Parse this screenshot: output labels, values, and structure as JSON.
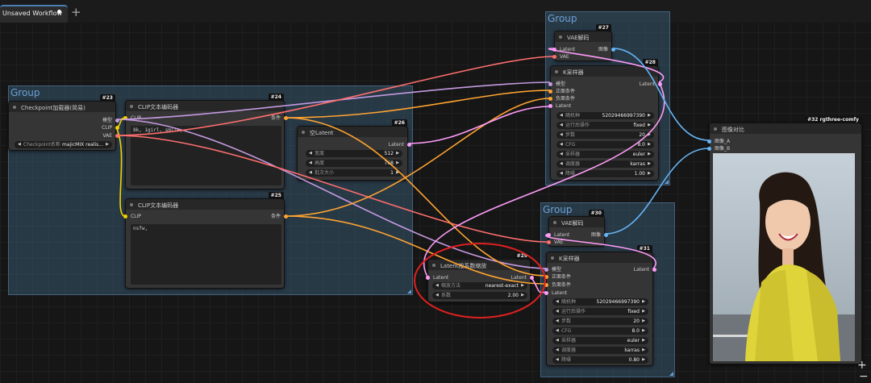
{
  "tabs": [
    {
      "label": "Unsaved Workflow",
      "modified": true
    }
  ],
  "new_tab_icon": "plus-icon",
  "groups": [
    {
      "title": "Group"
    },
    {
      "title": "Group"
    },
    {
      "title": "Group"
    }
  ],
  "nodes": {
    "n23": {
      "id": "#23",
      "title": "Checkpoint加载器(简易)",
      "outputs": {
        "model": "模型",
        "clip": "CLIP",
        "vae": "VAE"
      },
      "widget": {
        "name": "Checkpoint名称",
        "value": "majicMIX realis..."
      }
    },
    "n24": {
      "id": "#24",
      "title": "CLIP文本编码器",
      "input": "CLIP",
      "output": "条件",
      "text": "8k, 1girl, smile,"
    },
    "n25": {
      "id": "#25",
      "title": "CLIP文本编码器",
      "input": "CLIP",
      "output": "条件",
      "text": "nsfw,"
    },
    "n26": {
      "id": "#26",
      "title": "空Latent",
      "output": "Latent",
      "widgets": [
        {
          "name": "宽度",
          "value": "512"
        },
        {
          "name": "高度",
          "value": "768"
        },
        {
          "name": "批次大小",
          "value": "1"
        }
      ]
    },
    "n27": {
      "id": "#27",
      "title": "VAE解码",
      "inputs": [
        "Latent",
        "VAE"
      ],
      "output": "图像"
    },
    "n28": {
      "id": "#28",
      "title": "K采样器",
      "inputs": [
        "模型",
        "正面条件",
        "负面条件",
        "Latent"
      ],
      "output": "Latent",
      "widgets": [
        {
          "name": "随机种",
          "value": "520294669973​90"
        },
        {
          "name": "运行后操作",
          "value": "fixed"
        },
        {
          "name": "步数",
          "value": "20"
        },
        {
          "name": "CFG",
          "value": "8.0"
        },
        {
          "name": "采样器",
          "value": "euler"
        },
        {
          "name": "调度器",
          "value": "karras"
        },
        {
          "name": "降噪",
          "value": "1.00"
        }
      ]
    },
    "n29": {
      "id": "#29",
      "title": "Latent按系数缩放",
      "input": "Latent",
      "output": "Latent",
      "widgets": [
        {
          "name": "缩放方法",
          "value": "nearest-exact"
        },
        {
          "name": "系数",
          "value": "2.00"
        }
      ]
    },
    "n30": {
      "id": "#30",
      "title": "VAE解码",
      "inputs": [
        "Latent",
        "VAE"
      ],
      "output": "图像"
    },
    "n31": {
      "id": "#31",
      "title": "K采样器",
      "inputs": [
        "模型",
        "正面条件",
        "负面条件",
        "Latent"
      ],
      "output": "Latent",
      "widgets": [
        {
          "name": "随机种",
          "value": "520294669973​90"
        },
        {
          "name": "运行后操作",
          "value": "fixed"
        },
        {
          "name": "步数",
          "value": "20"
        },
        {
          "name": "CFG",
          "value": "8.0"
        },
        {
          "name": "采样器",
          "value": "euler"
        },
        {
          "name": "调度器",
          "value": "karras"
        },
        {
          "name": "降噪",
          "value": "0.80"
        }
      ]
    },
    "n32": {
      "id": "#32 rgthree-comfy",
      "title": "图像对比",
      "inputs": [
        "图像_A",
        "图像_B"
      ]
    }
  },
  "colors": {
    "model": "#c59ae0",
    "clip": "#f5d300",
    "vae": "#ff6e6e",
    "conditioning": "#ffa431",
    "latent": "#ff9cf9",
    "image": "#64b5f6",
    "group": "#385870",
    "annotation": "#e02020"
  },
  "zoom_controls": {
    "plus": "+",
    "minus": "−"
  }
}
